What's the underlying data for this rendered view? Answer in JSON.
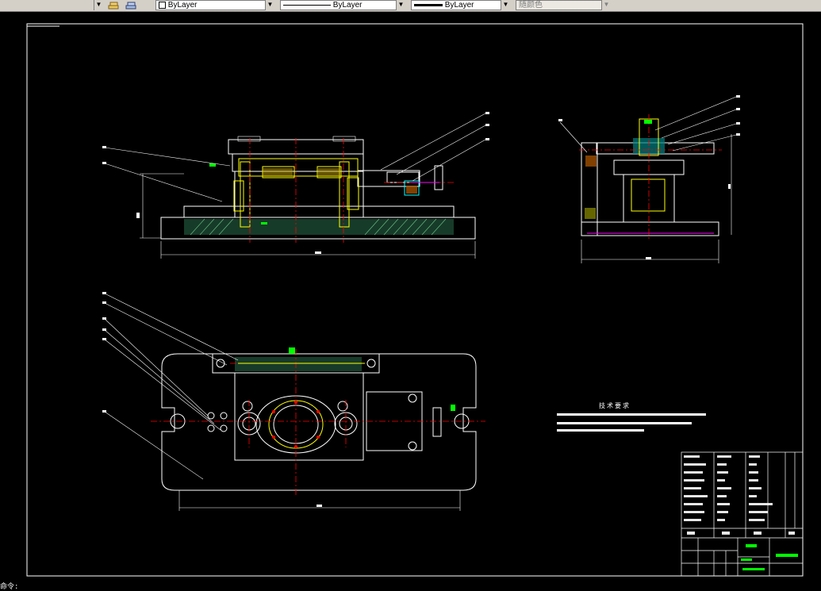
{
  "toolbar": {
    "layer_state_icon": "layer-stack-icon",
    "layer_prev_icon": "layer-previous-icon",
    "layer_value": "ByLayer",
    "linetype_value": "ByLayer",
    "lineweight_value": "ByLayer",
    "plotstyle_value": "随颜色"
  },
  "drawing": {
    "tech_req_title": "技术要求"
  },
  "command_line": {
    "prompt": "命令:"
  },
  "colors": {
    "background": "#000000",
    "white_lines": "#ffffff",
    "center_lines": "#ff0000",
    "dimension_lines": "#00ff00",
    "hatch": "#ffff00",
    "section_hatch": "#00ffff",
    "accent_magenta": "#ff00ff"
  }
}
